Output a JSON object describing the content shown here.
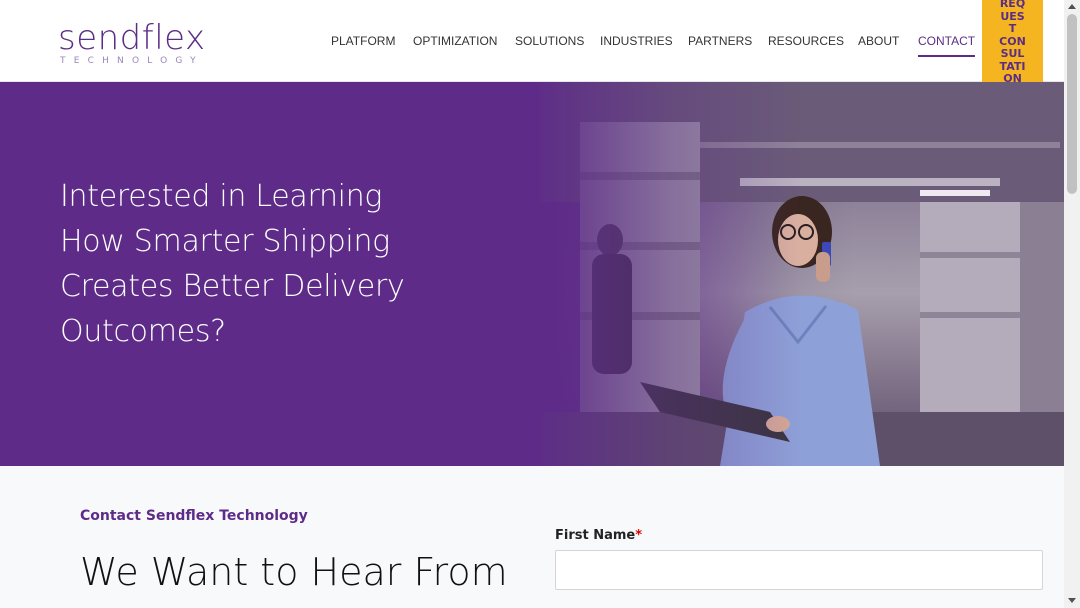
{
  "brand": {
    "name": "sendflex",
    "tagline": "TECHNOLOGY",
    "color": "#5e2c88"
  },
  "nav": {
    "items": [
      {
        "label": "PLATFORM"
      },
      {
        "label": "OPTIMIZATION"
      },
      {
        "label": "SOLUTIONS"
      },
      {
        "label": "INDUSTRIES"
      },
      {
        "label": "PARTNERS"
      },
      {
        "label": "RESOURCES"
      },
      {
        "label": "ABOUT"
      },
      {
        "label": "CONTACT"
      }
    ],
    "active": "CONTACT",
    "cta_label": "REQUEST CONSULTATION",
    "cta_lines": [
      "REQ",
      "UES",
      "T",
      "CON",
      "SUL",
      "TATI",
      "ON"
    ],
    "cta_color": "#f5b521"
  },
  "hero": {
    "title_lines": [
      "Interested in Learning",
      "How Smarter Shipping",
      "Creates Better Delivery",
      "Outcomes?"
    ]
  },
  "contact": {
    "eyebrow": "Contact Sendflex Technology",
    "heading": "We Want to Hear From",
    "first_name_label": "First Name",
    "required_mark": "*",
    "first_name_value": ""
  }
}
